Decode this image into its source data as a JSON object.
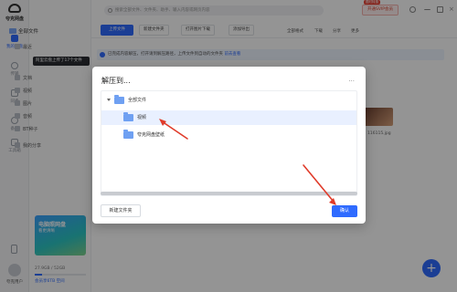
{
  "app": {
    "logo_text": "夸克网盘",
    "user_name": "夸克用户"
  },
  "rail": [
    {
      "label": "我的网盘",
      "active": true
    },
    {
      "label": "传输",
      "active": false
    },
    {
      "label": "同步",
      "active": false
    },
    {
      "label": "备份",
      "active": false
    },
    {
      "label": "工具箱",
      "active": false
    }
  ],
  "sidebar": {
    "head": "全部文件",
    "items": [
      "最近",
      "文档",
      "视频",
      "图片",
      "音频",
      "BT种子",
      "我的分享"
    ],
    "tooltip": "阿里云盘上传了17个文件",
    "promo_title": "电脑照网盘",
    "promo_sub": "看更清晰",
    "storage_text": "27.9GB / 52GB",
    "storage_fraction": 0.14,
    "storage_link": "会员享6TB 空间"
  },
  "topbar": {
    "search_placeholder": "搜索全部文件、文件夹、助手、输入内容或网页内容",
    "vip_label": "开通SVIP会员",
    "vip_badge": "限时特惠"
  },
  "toolbar": {
    "upload": "上传文件",
    "new_folder": "新建文件夹",
    "import": "打开图片下载",
    "more": "添加导出",
    "tools": [
      "全部格式",
      "下载",
      "分享",
      "更多"
    ]
  },
  "notice": {
    "text": "已完成内容解压，打开请到解压路径，上传文件到自动的文件夹",
    "link": "前去查看"
  },
  "background_file": {
    "label": "116115.jpg"
  },
  "fab": "+",
  "dialog": {
    "title": "解压到...",
    "close": "...",
    "tree": [
      {
        "label": "全部文件",
        "level": 0,
        "expanded": true,
        "selected": false
      },
      {
        "label": "视频",
        "level": 1,
        "expanded": false,
        "selected": true
      },
      {
        "label": "夸克网盘壁纸",
        "level": 1,
        "expanded": false,
        "selected": false
      }
    ],
    "new_folder_button": "新建文件夹",
    "confirm_button": "确认"
  },
  "colors": {
    "accent": "#2f6bff",
    "annotation": "#e03b2a"
  }
}
